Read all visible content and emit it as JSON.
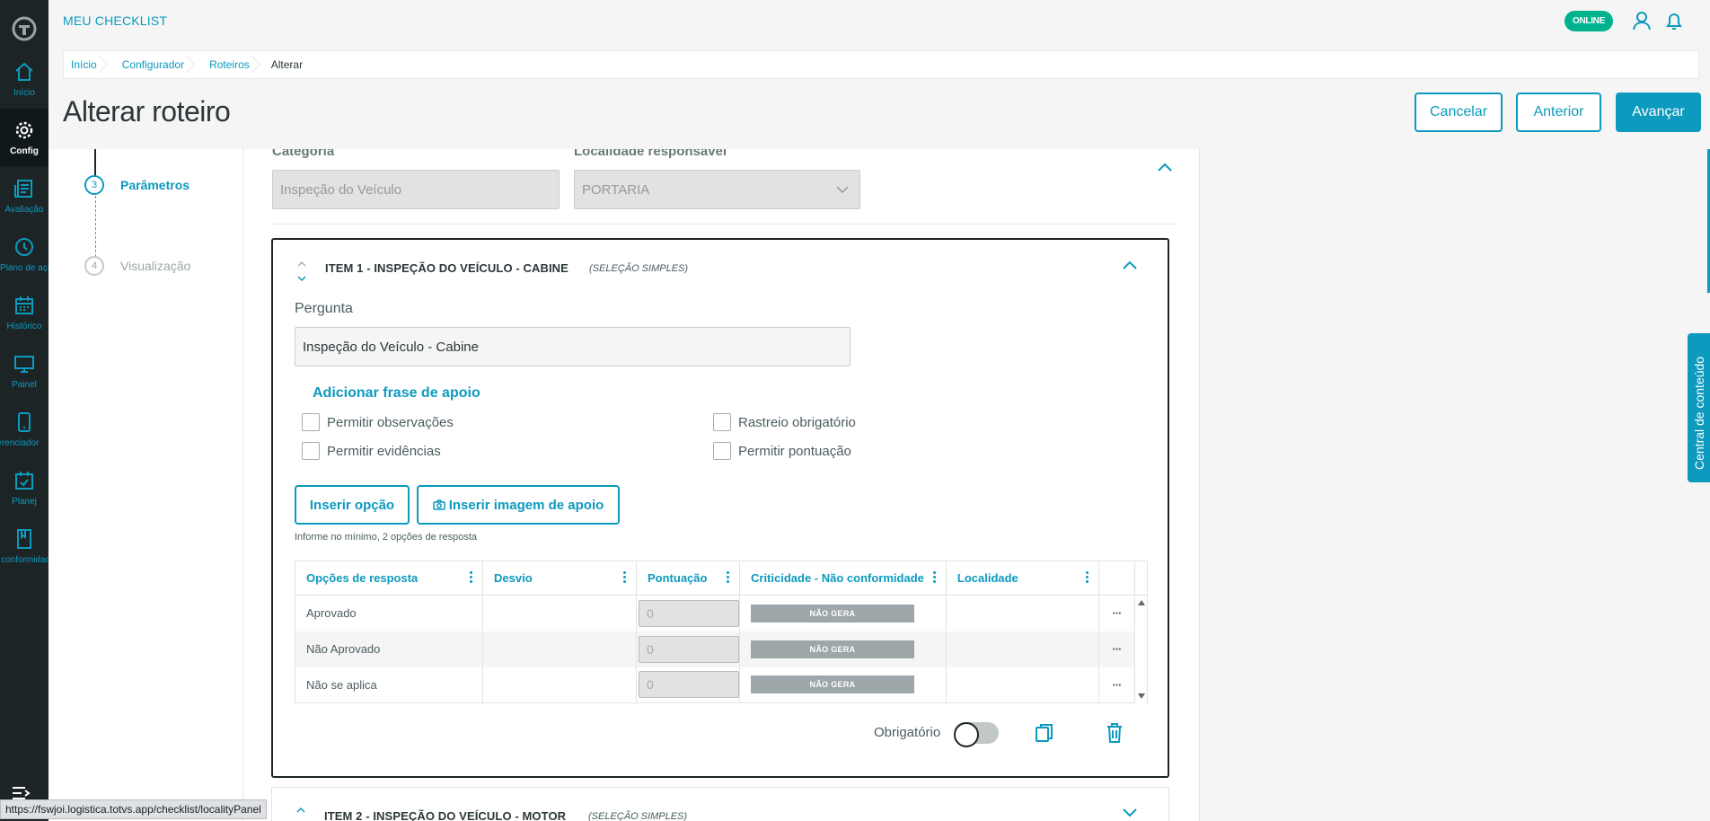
{
  "app": {
    "title": "MEU CHECKLIST",
    "status": "ONLINE"
  },
  "sidebar": {
    "items": [
      {
        "label": "Início",
        "icon": "home-icon"
      },
      {
        "label": "Config",
        "icon": "gear-icon",
        "active": true
      },
      {
        "label": "Avaliação",
        "icon": "report-icon"
      },
      {
        "label": "Plano de ação",
        "icon": "clock-icon"
      },
      {
        "label": "Histórico",
        "icon": "calendar-icon"
      },
      {
        "label": "Painel",
        "icon": "monitor-icon"
      },
      {
        "label": "Gerenciador",
        "icon": "phone-icon"
      },
      {
        "label": "Planej",
        "icon": "calendar-check-icon"
      },
      {
        "label": "Não conformidade",
        "icon": "book-icon"
      }
    ]
  },
  "breadcrumb": [
    "Início",
    "Configurador",
    "Roteiros",
    "Alterar"
  ],
  "page": {
    "title": "Alterar roteiro"
  },
  "actions": {
    "cancel": "Cancelar",
    "previous": "Anterior",
    "next": "Avançar"
  },
  "stepper": {
    "steps": [
      {
        "number": "3",
        "label": "Parâmetros",
        "state": "active"
      },
      {
        "number": "4",
        "label": "Visualização",
        "state": "pending"
      }
    ]
  },
  "header_fields": {
    "category_label": "Categoria",
    "category_value": "Inspeção do Veículo",
    "locality_label": "Localidade responsável",
    "locality_value": "PORTARIA"
  },
  "item1": {
    "title": "ITEM 1 - INSPEÇÃO DO VEÍCULO - CABINE",
    "subtitle": "(SELEÇÃO SIMPLES)",
    "question_label": "Pergunta",
    "question_value": "Inspeção do Veículo - Cabine",
    "add_phrase": "Adicionar frase de apoio",
    "checkboxes": {
      "observations": "Permitir observações",
      "evidence": "Permitir evidências",
      "tracking": "Rastreio obrigatório",
      "scoring": "Permitir pontuação"
    },
    "insert_option": "Inserir opção",
    "insert_image": "Inserir imagem de apoio",
    "hint": "Informe no mínimo, 2 opções de resposta",
    "grid": {
      "columns": [
        "Opções de resposta",
        "Desvio",
        "Pontuação",
        "Criticidade - Não conformidade",
        "Localidade"
      ],
      "rows": [
        {
          "option": "Aprovado",
          "deviation": "",
          "score": "0",
          "criticality": "NÃO GERA",
          "locality": "",
          "more": "···"
        },
        {
          "option": "Não Aprovado",
          "deviation": "",
          "score": "0",
          "criticality": "NÃO GERA",
          "locality": "",
          "more": "···"
        },
        {
          "option": "Não se aplica",
          "deviation": "",
          "score": "0",
          "criticality": "NÃO GERA",
          "locality": "",
          "more": "···"
        }
      ]
    },
    "required_label": "Obrigatório",
    "required": false
  },
  "item2": {
    "title": "ITEM 2 - INSPEÇÃO DO VEÍCULO - MOTOR",
    "subtitle": "(SELEÇÃO SIMPLES)"
  },
  "side_panel": {
    "label": "Central de conteúdo"
  },
  "status_bar": {
    "url": "https://fswjoi.logistica.totvs.app/checklist/localityPanel"
  },
  "colors": {
    "primary": "#0c9abe",
    "sidebar": "#1d2426",
    "online": "#00b28e"
  }
}
